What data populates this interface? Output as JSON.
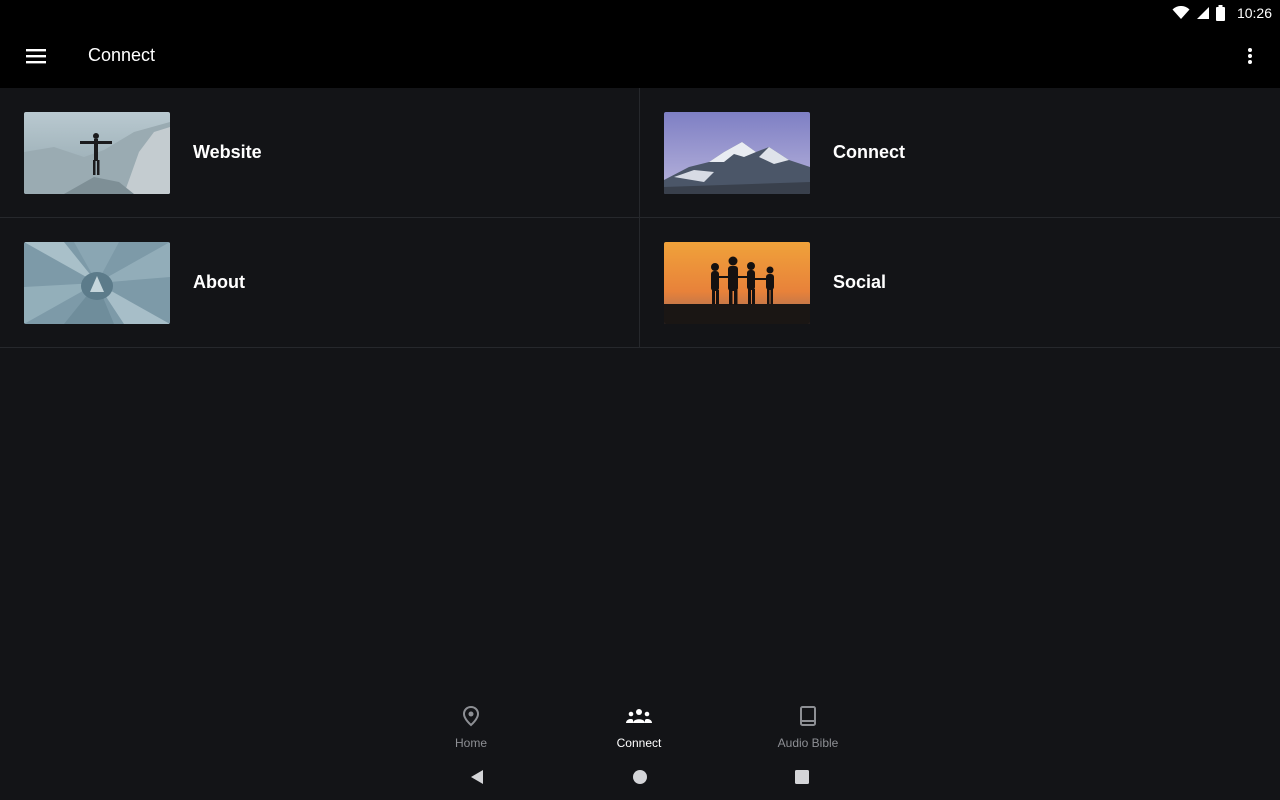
{
  "status_bar": {
    "time": "10:26",
    "icons": [
      "wifi-icon",
      "cell-signal-icon",
      "battery-icon"
    ]
  },
  "app_bar": {
    "title": "Connect",
    "menu_icon": "hamburger-menu-icon",
    "overflow_icon": "more-vertical-icon"
  },
  "tiles": [
    {
      "label": "Website",
      "image": "person-on-cliff-image"
    },
    {
      "label": "Connect",
      "image": "snowy-mountain-image"
    },
    {
      "label": "About",
      "image": "succulent-plant-image"
    },
    {
      "label": "Social",
      "image": "family-sunset-silhouette-image"
    }
  ],
  "bottom_nav": {
    "items": [
      {
        "label": "Home",
        "icon": "location-pin-icon",
        "active": false
      },
      {
        "label": "Connect",
        "icon": "group-icon",
        "active": true
      },
      {
        "label": "Audio Bible",
        "icon": "book-icon",
        "active": false
      }
    ]
  },
  "colors": {
    "background": "#131417",
    "app_bar": "#000000",
    "divider": "#26282c",
    "inactive_nav": "#8d8f94",
    "active_nav": "#ffffff"
  }
}
